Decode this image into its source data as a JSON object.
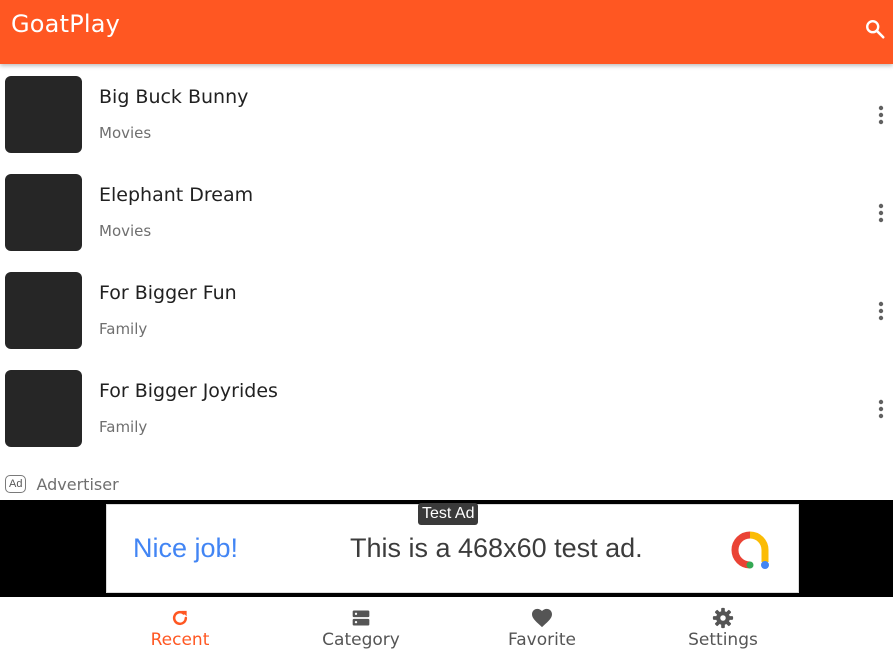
{
  "appbar": {
    "title": "GoatPlay",
    "search_icon": "search-icon"
  },
  "videos": [
    {
      "title": "Big Buck Bunny",
      "category": "Movies"
    },
    {
      "title": "Elephant Dream",
      "category": "Movies"
    },
    {
      "title": "For Bigger Fun",
      "category": "Family"
    },
    {
      "title": "For Bigger Joyrides",
      "category": "Family"
    }
  ],
  "ad": {
    "chip": "Ad",
    "advertiser": "Advertiser",
    "badge": "Test Ad",
    "headline": "Nice job!",
    "body": "This is a 468x60 test ad."
  },
  "bottom_nav": [
    {
      "label": "Recent",
      "icon": "refresh-icon",
      "active": true
    },
    {
      "label": "Category",
      "icon": "category-icon",
      "active": false
    },
    {
      "label": "Favorite",
      "icon": "heart-icon",
      "active": false
    },
    {
      "label": "Settings",
      "icon": "gear-icon",
      "active": false
    }
  ],
  "colors": {
    "primary": "#ff5722",
    "thumbnail": "#262626",
    "ad_headline": "#4285f4"
  }
}
